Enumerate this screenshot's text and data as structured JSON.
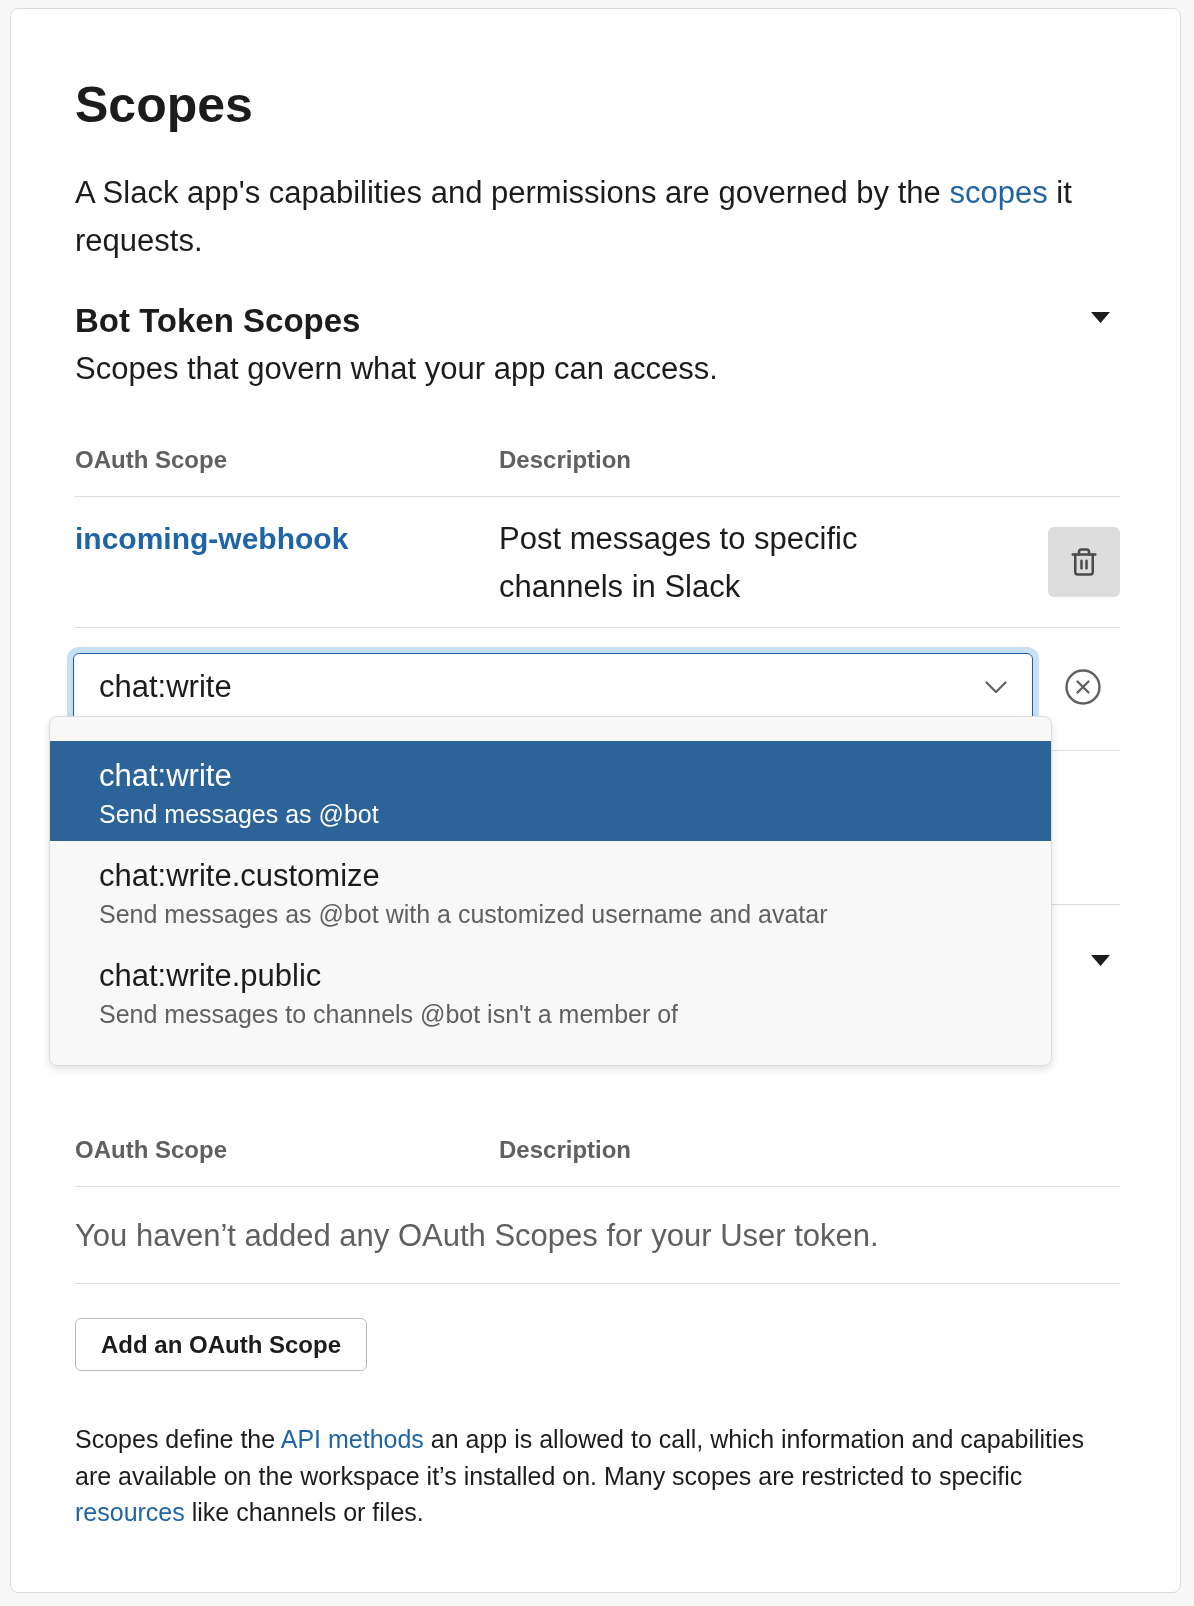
{
  "page": {
    "title": "Scopes",
    "intro": [
      {
        "kind": "text",
        "text": "A Slack app's capabilities and permissions are governed by the "
      },
      {
        "kind": "link",
        "text": "scopes"
      },
      {
        "kind": "text",
        "text": " it requests."
      }
    ]
  },
  "bot_token_scopes": {
    "title": "Bot Token Scopes",
    "expanded": true,
    "description": "Scopes that govern what your app can access.",
    "table": {
      "columns": [
        "OAuth Scope",
        "Description"
      ],
      "rows": [
        {
          "scope": "incoming-webhook",
          "description": "Post messages to specific channels in Slack"
        }
      ]
    },
    "scope_select": {
      "value": "chat:write",
      "focused": true,
      "open": true,
      "options": [
        {
          "name": "chat:write",
          "description": "Send messages as @bot",
          "selected": true
        },
        {
          "name": "chat:write.customize",
          "description": "Send messages as @bot with a customized username and avatar",
          "selected": false
        },
        {
          "name": "chat:write.public",
          "description": "Send messages to channels @bot isn't a member of",
          "selected": false
        }
      ]
    }
  },
  "user_token_section": {
    "expanded": true,
    "table": {
      "columns": [
        "OAuth Scope",
        "Description"
      ],
      "empty_message": "You haven’t added any OAuth Scopes for your User token."
    },
    "add_button": "Add an OAuth Scope"
  },
  "footer": [
    {
      "kind": "text",
      "text": "Scopes define the "
    },
    {
      "kind": "link",
      "text": "API methods"
    },
    {
      "kind": "text",
      "text": " an app is allowed to call, which information and capabilities are available on the workspace it’s installed on. Many scopes are restricted to specific "
    },
    {
      "kind": "link",
      "text": "resources"
    },
    {
      "kind": "text",
      "text": " like channels or files."
    }
  ]
}
